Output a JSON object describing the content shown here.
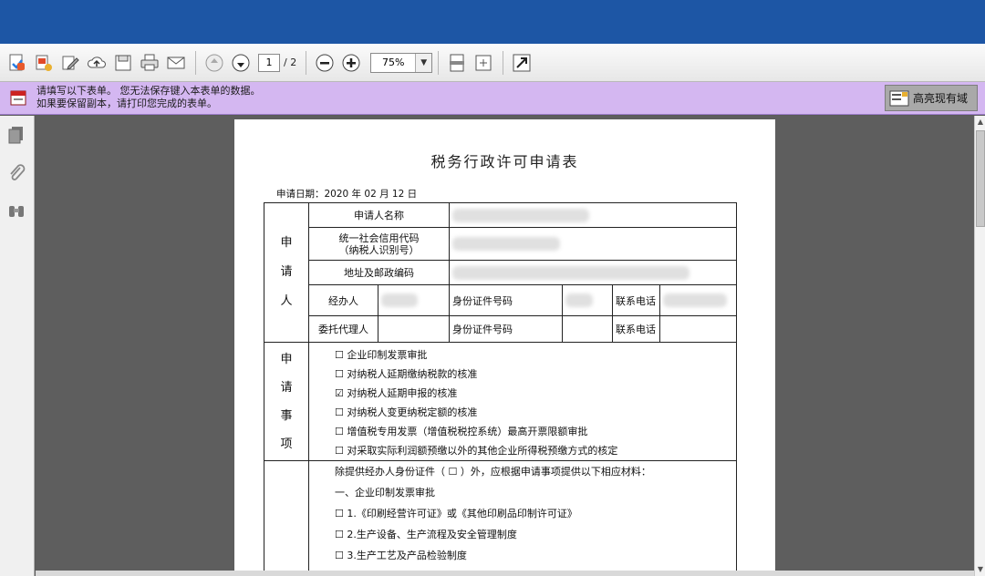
{
  "toolbar": {
    "page_current": "1",
    "page_total": "/ 2",
    "zoom": "75%",
    "icons": [
      "create-pdf-icon",
      "export-icon",
      "edit-icon",
      "cloud-upload-icon",
      "save-icon",
      "print-icon",
      "email-icon",
      "previous-page-icon",
      "next-page-icon",
      "zoom-out-icon",
      "zoom-in-icon",
      "scroll-mode-icon",
      "fit-page-icon",
      "fullscreen-icon"
    ]
  },
  "form_bar": {
    "line1": "请填写以下表单。 您无法保存键入本表单的数据。",
    "line2": "如果要保留副本，请打印您完成的表单。",
    "highlight_button": "高亮现有域",
    "bg_color": "#d4b7f1"
  },
  "sidebar": {
    "icons": [
      "pages-icon",
      "attachment-icon",
      "search-binoculars-icon"
    ]
  },
  "document": {
    "title": "税务行政许可申请表",
    "date_label": "申请日期：2020 年 02 月 12 日",
    "applicant": {
      "section_chars": [
        "申",
        "请",
        "人"
      ],
      "name_label": "申请人名称",
      "credit_code_label": "统一社会信用代码（纳税人识别号）",
      "credit_code_line1": "统一社会信用代码",
      "credit_code_line2": "（纳税人识别号）",
      "address_label": "地址及邮政编码",
      "agent_label": "经办人",
      "id_label": "身份证件号码",
      "phone_label": "联系电话",
      "proxy_label": "委托代理人"
    },
    "items": {
      "section_chars": [
        "申",
        "请",
        "事",
        "项"
      ],
      "list": [
        {
          "box": "☐",
          "text": "企业印制发票审批"
        },
        {
          "box": "☐",
          "text": "对纳税人延期缴纳税款的核准"
        },
        {
          "box": "☑",
          "text": "对纳税人延期申报的核准"
        },
        {
          "box": "☐",
          "text": "对纳税人变更纳税定额的核准"
        },
        {
          "box": "☐",
          "text": "增值税专用发票（增值税税控系统）最高开票限额审批"
        },
        {
          "box": "☐",
          "text": "对采取实际利润额预缴以外的其他企业所得税预缴方式的核定"
        }
      ]
    },
    "materials": {
      "intro": "除提供经办人身份证件（ ☐ ）外，应根据申请事项提供以下相应材料：",
      "heading": "一、企业印制发票审批",
      "list": [
        {
          "box": "☐",
          "text": "1.《印刷经营许可证》或《其他印刷品印制许可证》"
        },
        {
          "box": "☐",
          "text": "2.生产设备、生产流程及安全管理制度"
        },
        {
          "box": "☐",
          "text": "3.生产工艺及产品检验制度"
        }
      ]
    }
  },
  "colors": {
    "titlebar": "#1d56a5",
    "doc_bg": "#5e5e5e"
  }
}
